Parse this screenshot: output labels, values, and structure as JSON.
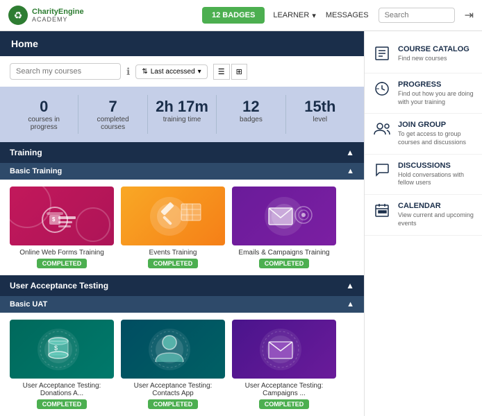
{
  "header": {
    "logo_name": "CharityEngine",
    "logo_sub": "ACADEMY",
    "badges_label": "12 BADGES",
    "learner_label": "LEARNER",
    "messages_label": "MESSAGES",
    "search_placeholder": "Search",
    "logout_icon": "→"
  },
  "page": {
    "title": "Home"
  },
  "search_bar": {
    "placeholder": "Search my courses",
    "last_accessed": "Last accessed",
    "info_icon": "ℹ",
    "grid_icon": "☰",
    "tile_icon": "⊞"
  },
  "stats": [
    {
      "value": "0",
      "label": "courses in progress"
    },
    {
      "value": "7",
      "label": "completed courses"
    },
    {
      "value": "2h 17m",
      "label": "training time"
    },
    {
      "value": "12",
      "label": "badges"
    },
    {
      "value": "15th",
      "label": "level"
    }
  ],
  "training_section": {
    "title": "Training",
    "subsection": "Basic Training"
  },
  "basic_training_cards": [
    {
      "title": "Online Web Forms Training",
      "status": "COMPLETED",
      "color": "pink",
      "icon": "🔒"
    },
    {
      "title": "Events Training",
      "status": "COMPLETED",
      "color": "gold",
      "icon": "⚖"
    },
    {
      "title": "Emails & Campaigns Training",
      "status": "COMPLETED",
      "color": "purple",
      "icon": "✉"
    }
  ],
  "uat_section": {
    "title": "User Acceptance Testing",
    "subsection": "Basic UAT"
  },
  "uat_cards": [
    {
      "title": "User Acceptance Testing: Donations A...",
      "status": "COMPLETED",
      "color": "teal",
      "icon": "💾"
    },
    {
      "title": "User Acceptance Testing: Contacts App",
      "status": "COMPLETED",
      "color": "dark-teal",
      "icon": "👤"
    },
    {
      "title": "User Acceptance Testing: Campaigns ...",
      "status": "COMPLETED",
      "color": "dark-purple",
      "icon": "✉"
    }
  ],
  "sidebar": {
    "items": [
      {
        "id": "course-catalog",
        "title": "COURSE CATALOG",
        "desc": "Find new courses",
        "icon": "📋"
      },
      {
        "id": "progress",
        "title": "PROGRESS",
        "desc": "Find out how you are doing with your training",
        "icon": "📊"
      },
      {
        "id": "join-group",
        "title": "JOIN GROUP",
        "desc": "To get access to group courses and discussions",
        "icon": "👥"
      },
      {
        "id": "discussions",
        "title": "DISCUSSIONS",
        "desc": "Hold conversations with fellow users",
        "icon": "💬"
      },
      {
        "id": "calendar",
        "title": "CALENDAR",
        "desc": "View current and upcoming events",
        "icon": "📅"
      }
    ]
  }
}
